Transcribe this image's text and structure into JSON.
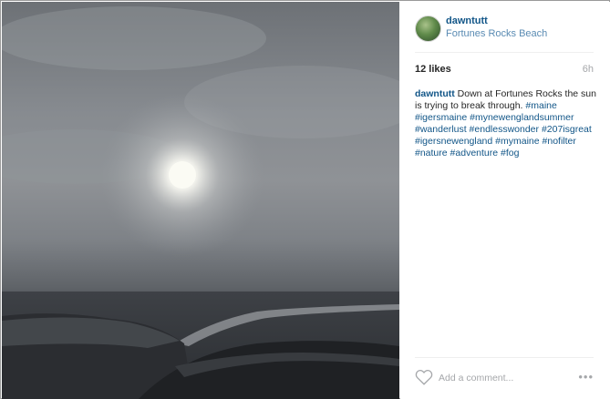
{
  "post": {
    "username": "dawntutt",
    "location": "Fortunes Rocks Beach",
    "likes": "12 likes",
    "age": "6h",
    "caption": {
      "username": "dawntutt",
      "text": " Down at Fortunes Rocks the sun is trying to break through. ",
      "hashtags": [
        "#maine",
        "#igersmaine",
        "#mynewenglandsummer",
        "#wanderlust",
        "#endlesswonder",
        "#207isgreat",
        "#igersnewengland",
        "#mymaine",
        "#nofilter",
        "#nature",
        "#adventure",
        "#fog"
      ]
    }
  },
  "comment_bar": {
    "placeholder": "Add a comment...",
    "more": "•••"
  },
  "icons": {
    "like": "heart-icon",
    "more": "more-options-icon"
  },
  "colors": {
    "link": "#125688",
    "muted": "#a5a7aa",
    "text": "#262626"
  }
}
